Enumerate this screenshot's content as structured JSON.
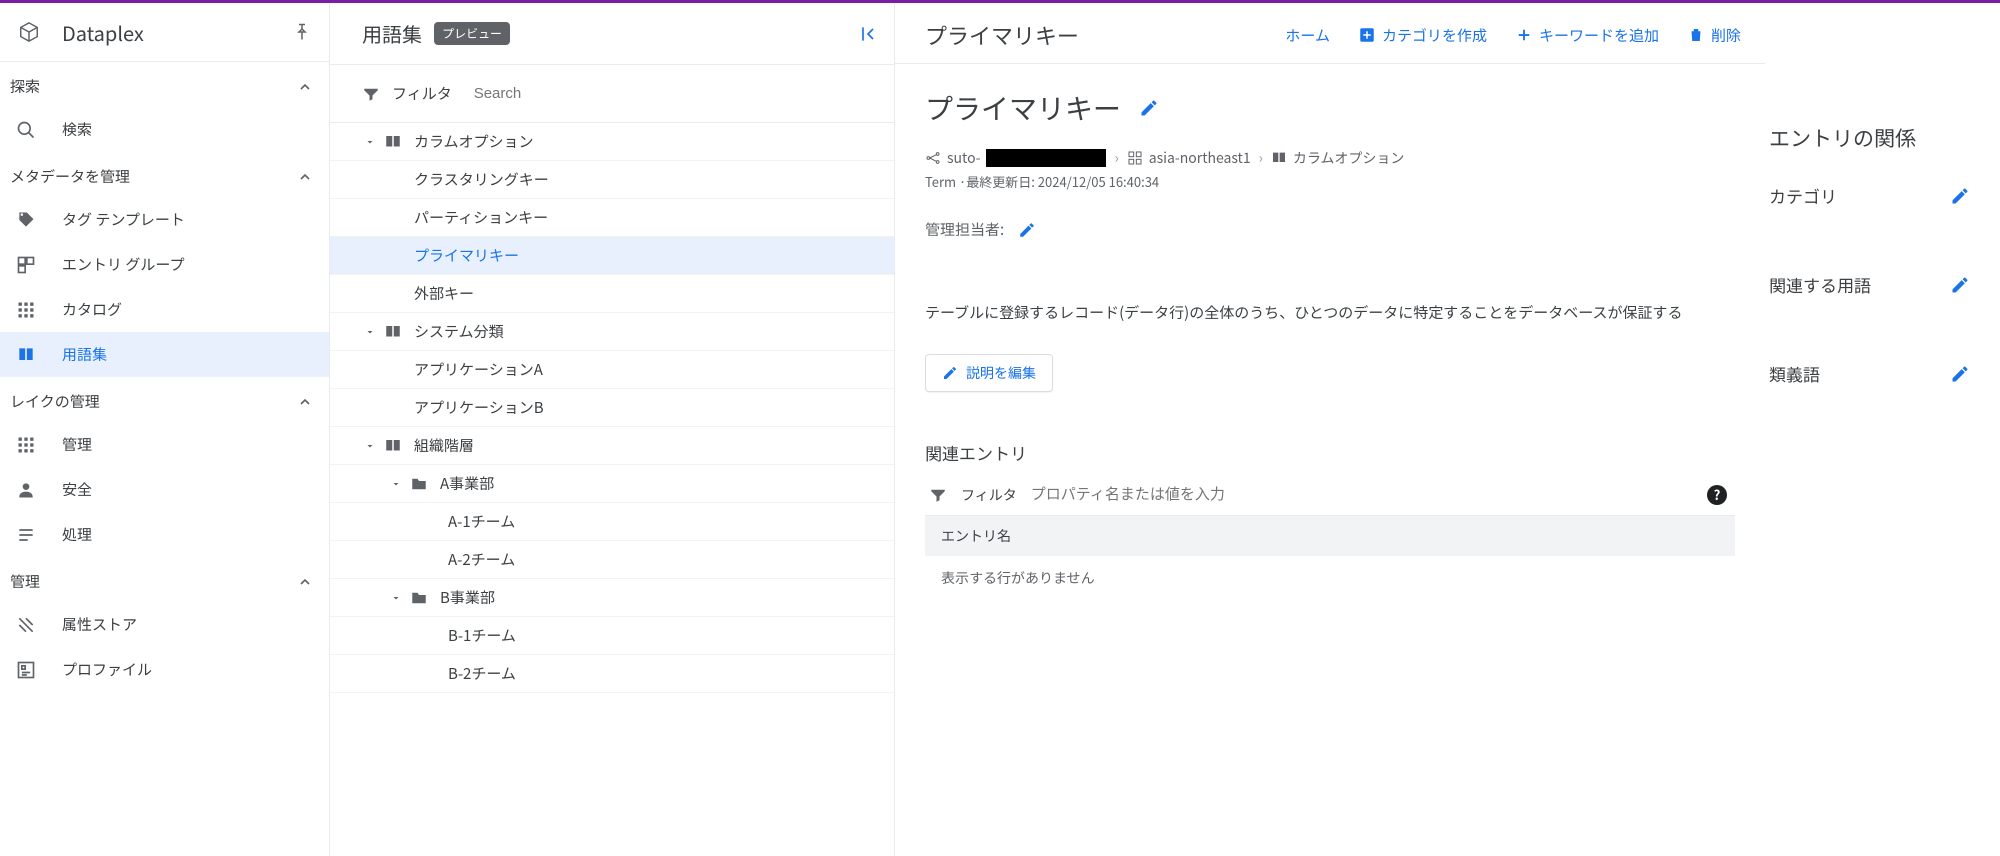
{
  "product": {
    "name": "Dataplex"
  },
  "sidebar": {
    "sections": [
      {
        "title": "探索",
        "items": [
          {
            "icon": "search-icon",
            "label": "検索"
          }
        ]
      },
      {
        "title": "メタデータを管理",
        "items": [
          {
            "icon": "tag-icon",
            "label": "タグ テンプレート"
          },
          {
            "icon": "entry-group-icon",
            "label": "エントリ グループ"
          },
          {
            "icon": "catalog-icon",
            "label": "カタログ"
          },
          {
            "icon": "glossary-icon",
            "label": "用語集",
            "active": true
          }
        ]
      },
      {
        "title": "レイクの管理",
        "items": [
          {
            "icon": "manage-icon",
            "label": "管理"
          },
          {
            "icon": "security-icon",
            "label": "安全"
          },
          {
            "icon": "process-icon",
            "label": "処理"
          }
        ]
      },
      {
        "title": "管理",
        "items": [
          {
            "icon": "attr-store-icon",
            "label": "属性ストア"
          },
          {
            "icon": "profile-icon",
            "label": "プロファイル"
          }
        ]
      }
    ]
  },
  "tree": {
    "title": "用語集",
    "badge": "プレビュー",
    "filter_label": "フィルタ",
    "search_placeholder": "Search",
    "nodes": [
      {
        "type": "category",
        "indent": 1,
        "arrow": true,
        "icon": "book",
        "label": "カラムオプション"
      },
      {
        "type": "term",
        "leaf_indent": 1,
        "label": "クラスタリングキー"
      },
      {
        "type": "term",
        "leaf_indent": 1,
        "label": "パーティションキー"
      },
      {
        "type": "term",
        "leaf_indent": 1,
        "label": "プライマリキー",
        "selected": true
      },
      {
        "type": "term",
        "leaf_indent": 1,
        "label": "外部キー"
      },
      {
        "type": "category",
        "indent": 1,
        "arrow": true,
        "icon": "book",
        "label": "システム分類"
      },
      {
        "type": "term",
        "leaf_indent": 1,
        "label": "アプリケーションA"
      },
      {
        "type": "term",
        "leaf_indent": 1,
        "label": "アプリケーションB"
      },
      {
        "type": "category",
        "indent": 1,
        "arrow": true,
        "icon": "book",
        "label": "組織階層"
      },
      {
        "type": "category",
        "indent": 2,
        "arrow": true,
        "icon": "folder",
        "label": "A事業部"
      },
      {
        "type": "term",
        "leaf_indent": 2,
        "label": "A-1チーム"
      },
      {
        "type": "term",
        "leaf_indent": 2,
        "label": "A-2チーム"
      },
      {
        "type": "category",
        "indent": 2,
        "arrow": true,
        "icon": "folder",
        "label": "B事業部"
      },
      {
        "type": "term",
        "leaf_indent": 2,
        "label": "B-1チーム"
      },
      {
        "type": "term",
        "leaf_indent": 2,
        "label": "B-2チーム"
      }
    ]
  },
  "detail": {
    "header": {
      "title": "プライマリキー",
      "actions": {
        "home": "ホーム",
        "create_category": "カテゴリを作成",
        "add_keyword": "キーワードを追加",
        "delete": "削除"
      }
    },
    "title": "プライマリキー",
    "breadcrumb": {
      "project_prefix": "suto-",
      "region": "asia-northeast1",
      "category": "カラムオプション"
    },
    "meta": "Term ·最終更新日: 2024/12/05 16:40:34",
    "manager_label": "管理担当者:",
    "description": "テーブルに登録するレコード(データ行)の全体のうち、ひとつのデータに特定することをデータベースが保証する",
    "edit_desc": "説明を編集",
    "related_entries": {
      "title": "関連エントリ",
      "filter_label": "フィルタ",
      "filter_placeholder": "プロパティ名または値を入力",
      "th_name": "エントリ名",
      "empty": "表示する行がありません"
    }
  },
  "rail": {
    "heading": "エントリの関係",
    "items": [
      {
        "label": "カテゴリ"
      },
      {
        "label": "関連する用語"
      },
      {
        "label": "類義語"
      }
    ]
  }
}
